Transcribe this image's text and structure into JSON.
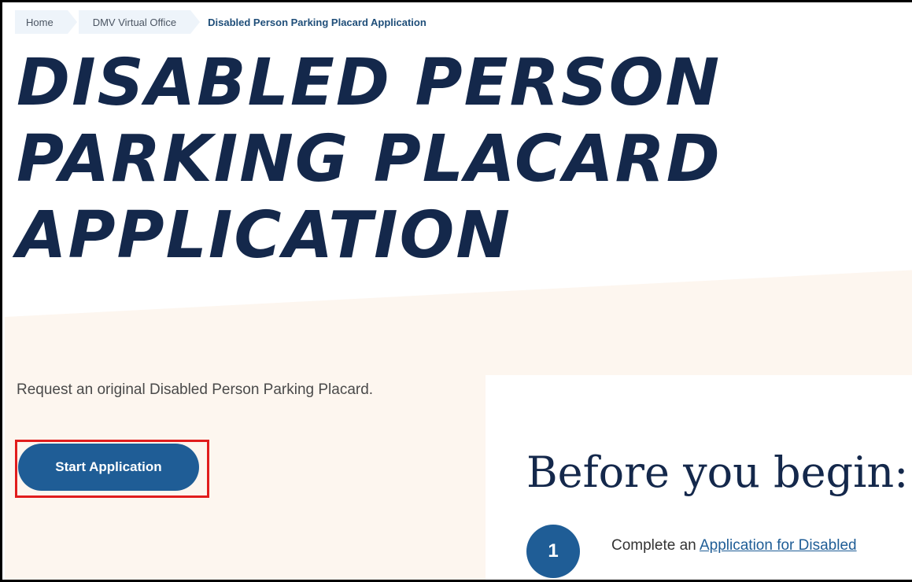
{
  "breadcrumb": {
    "items": [
      "Home",
      "DMV Virtual Office"
    ],
    "current": "Disabled Person Parking Placard Application"
  },
  "page": {
    "title": "DISABLED PERSON PARKING PLACARD APPLICATION",
    "intro": "Request an original Disabled Person Parking Placard.",
    "start_button": "Start Application"
  },
  "card": {
    "heading": "Before you begin:",
    "steps": [
      {
        "number": "1",
        "text": "Complete an ",
        "link": "Application for Disabled"
      }
    ]
  },
  "colors": {
    "title": "#14284b",
    "accent": "#1f5d96",
    "band": "#fdf6ef",
    "highlight": "#e11d1d"
  }
}
